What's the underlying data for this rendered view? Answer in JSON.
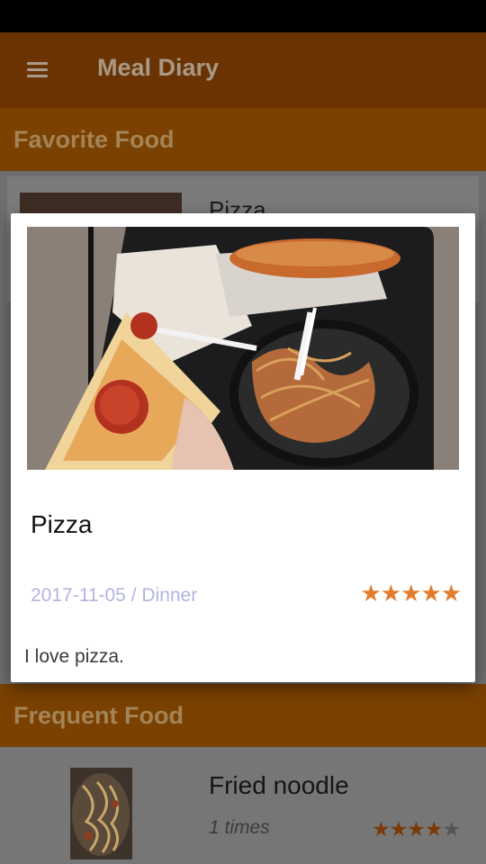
{
  "app": {
    "title": "Meal Diary"
  },
  "icons": {
    "menu": "hamburger-menu-icon",
    "star": "star-icon"
  },
  "colors": {
    "app_bar": "#e06800",
    "section_header": "#f08a00",
    "star_active": "#e47c2d",
    "star_inactive": "#9e9e9e",
    "date_text": "#b3b3e0"
  },
  "favorite": {
    "header": "Favorite Food",
    "items": [
      {
        "name": "Pizza"
      }
    ]
  },
  "dialog": {
    "name": "Pizza",
    "date_meal": "2017-11-05 / Dinner",
    "rating": 5,
    "rating_max": 5,
    "comment": "I love pizza."
  },
  "frequent": {
    "header": "Frequent Food",
    "items": [
      {
        "name": "Fried noodle",
        "count": "1 times",
        "rating": 4,
        "rating_max": 5
      }
    ]
  }
}
